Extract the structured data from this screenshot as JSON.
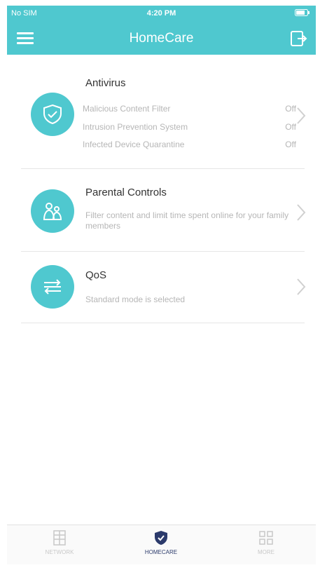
{
  "status_bar": {
    "carrier": "No SIM",
    "time": "4:20 PM"
  },
  "header": {
    "title": "HomeCare"
  },
  "antivirus": {
    "title": "Antivirus",
    "rows": [
      {
        "label": "Malicious Content Filter",
        "value": "Off"
      },
      {
        "label": "Intrusion Prevention System",
        "value": "Off"
      },
      {
        "label": "Infected Device Quarantine",
        "value": "Off"
      }
    ]
  },
  "parental_controls": {
    "title": "Parental Controls",
    "description": "Filter content and limit time spent online for your family members"
  },
  "qos": {
    "title": "QoS",
    "description": "Standard mode is selected"
  },
  "bottom_nav": {
    "tabs": [
      {
        "label": "NETWORK",
        "icon": "network-icon",
        "active": false
      },
      {
        "label": "HOMECARE",
        "icon": "shield-icon",
        "active": true
      },
      {
        "label": "MORE",
        "icon": "more-grid-icon",
        "active": false
      }
    ]
  },
  "colors": {
    "accent": "#4fc8cf",
    "active_tab": "#2b3a6b",
    "muted_text": "#b6b6b6"
  }
}
